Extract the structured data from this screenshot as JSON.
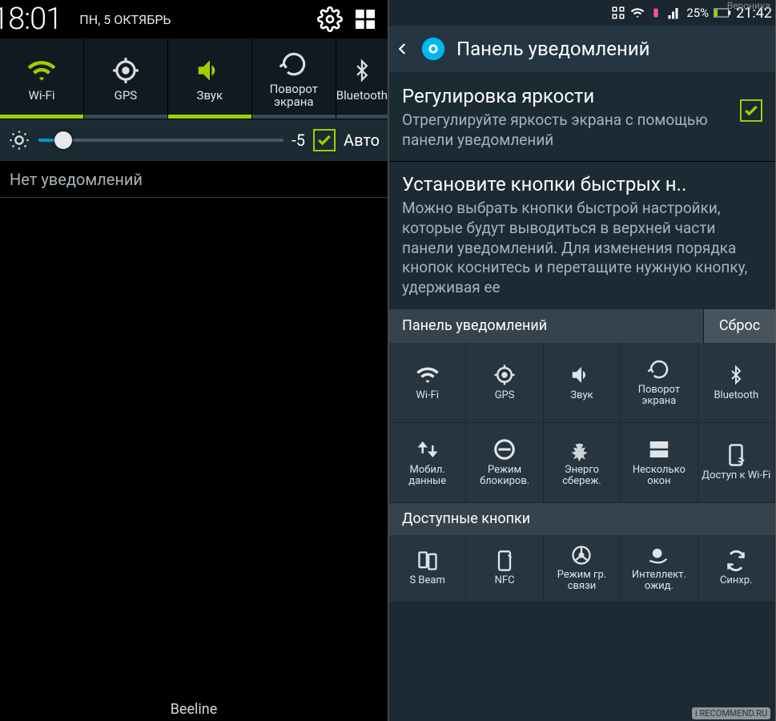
{
  "left": {
    "statusbar": {
      "clock": "18:01",
      "date": "ПН, 5 ОКТЯБРЬ"
    },
    "tiles": [
      {
        "name": "wifi",
        "label": "Wi-Fi",
        "active": true
      },
      {
        "name": "gps",
        "label": "GPS",
        "active": false
      },
      {
        "name": "sound",
        "label": "Звук",
        "active": true
      },
      {
        "name": "rotate",
        "label": "Поворот\nэкрана",
        "active": false
      },
      {
        "name": "bt",
        "label": "Bluetooth",
        "active": false
      }
    ],
    "brightness": {
      "value": "-5",
      "auto_label": "Авто"
    },
    "no_notifications": "Нет уведомлений",
    "carrier": "Beeline"
  },
  "right": {
    "statusbar": {
      "battery_pct": "25%",
      "clock": "21:42"
    },
    "header": "Панель уведомлений",
    "brightness_adj": {
      "title": "Регулировка яркости",
      "desc": "Отрегулируйте яркость экрана с помощью панели уведомлений",
      "checked": true
    },
    "quick_buttons": {
      "title": "Установите кнопки быстрых н..",
      "desc": "Можно выбрать кнопки быстрой настройки, которые будут выводиться в верхней части панели уведомлений. Для изменения порядка кнопок коснитесь и перетащите нужную кнопку, удерживая ее"
    },
    "panel_bar": {
      "label": "Панель уведомлений",
      "reset": "Сброс"
    },
    "grid": [
      {
        "name": "wifi",
        "label": "Wi-Fi"
      },
      {
        "name": "gps",
        "label": "GPS"
      },
      {
        "name": "sound",
        "label": "Звук"
      },
      {
        "name": "rotate",
        "label": "Поворот экрана"
      },
      {
        "name": "bt",
        "label": "Bluetooth"
      },
      {
        "name": "mobdata",
        "label": "Мобил. данные"
      },
      {
        "name": "blockmode",
        "label": "Режим блокиров."
      },
      {
        "name": "powersave",
        "label": "Энерго сбереж."
      },
      {
        "name": "multiwin",
        "label": "Несколько окон"
      },
      {
        "name": "wifiap",
        "label": "Доступ к Wi-Fi"
      }
    ],
    "avail_label": "Доступные кнопки",
    "avail_grid": [
      {
        "name": "sbeam",
        "label": "S Beam"
      },
      {
        "name": "nfc",
        "label": "NFC"
      },
      {
        "name": "drive",
        "label": "Режим гр. связи"
      },
      {
        "name": "smartstay",
        "label": "Интеллект. ожид."
      },
      {
        "name": "sync",
        "label": "Синхр."
      }
    ]
  },
  "watermarks": {
    "top": "Вероника",
    "bottom": "i RECOMMEND.RU"
  }
}
